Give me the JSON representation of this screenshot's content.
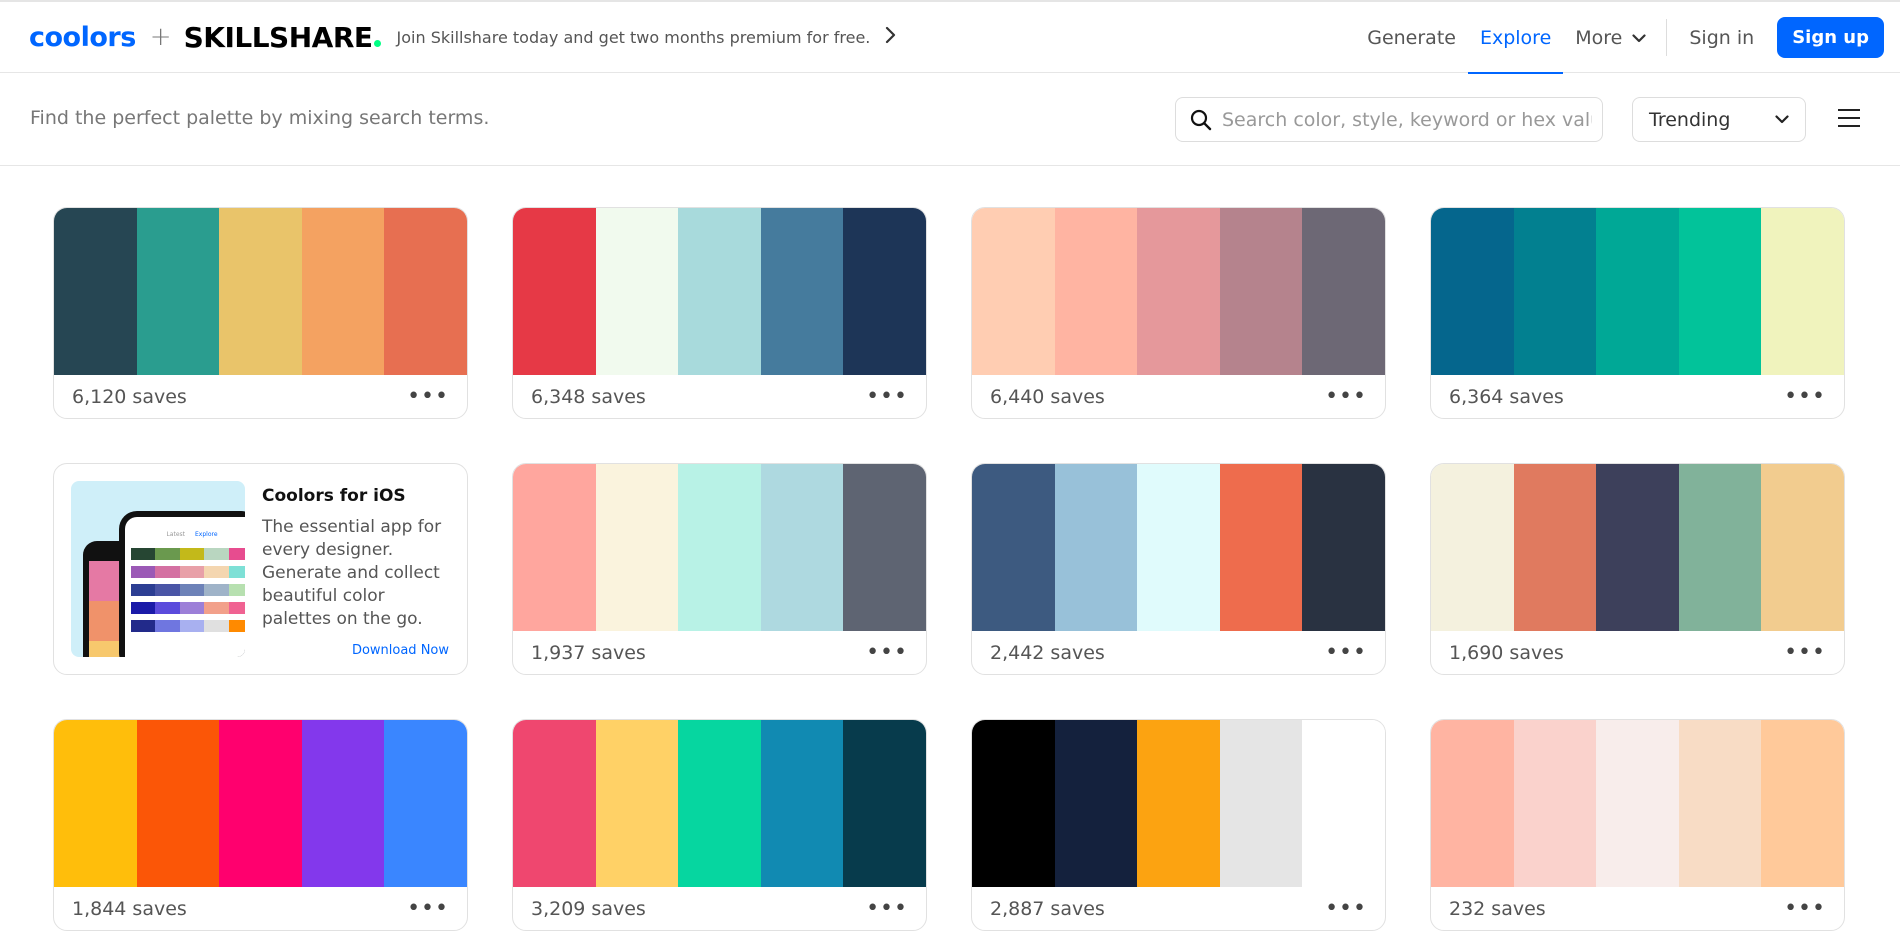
{
  "header": {
    "logo_coolors": "coolors",
    "plus": "+",
    "logo_skillshare": "SKILLSHARE",
    "promo_text": "Join Skillshare today and get two months premium for free.",
    "nav": {
      "generate": "Generate",
      "explore": "Explore",
      "more": "More",
      "sign_in": "Sign in",
      "sign_up": "Sign up"
    }
  },
  "subbar": {
    "tagline": "Find the perfect palette by mixing search terms.",
    "search_placeholder": "Search color, style, keyword or hex value",
    "sort_value": "Trending"
  },
  "promo_card": {
    "title": "Coolors for iOS",
    "description": "The essential app for every designer. Generate and collect beautiful color palettes on the go.",
    "link": "Download Now",
    "phone_tabs": [
      "Latest",
      "Explore"
    ]
  },
  "palettes": [
    {
      "saves": "6,120 saves",
      "colors": [
        "#264653",
        "#2A9D8F",
        "#E9C46A",
        "#F4A261",
        "#E76F51"
      ]
    },
    {
      "saves": "6,348 saves",
      "colors": [
        "#E63946",
        "#F1FAEE",
        "#A8DADC",
        "#457B9D",
        "#1D3557"
      ]
    },
    {
      "saves": "6,440 saves",
      "colors": [
        "#FFCDB2",
        "#FFB4A2",
        "#E5989B",
        "#B5838D",
        "#6D6875"
      ]
    },
    {
      "saves": "6,364 saves",
      "colors": [
        "#05668D",
        "#028090",
        "#00A896",
        "#02C39A",
        "#F0F3BD"
      ]
    },
    {
      "promo": true
    },
    {
      "saves": "1,937 saves",
      "colors": [
        "#FFA69E",
        "#FAF3DD",
        "#B8F2E6",
        "#AED9E0",
        "#5E6472"
      ]
    },
    {
      "saves": "2,442 saves",
      "colors": [
        "#3D5A80",
        "#98C1D9",
        "#E0FBFC",
        "#EE6C4D",
        "#293241"
      ]
    },
    {
      "saves": "1,690 saves",
      "colors": [
        "#F4F1DE",
        "#E07A5F",
        "#3D405B",
        "#81B29A",
        "#F2CC8F"
      ]
    },
    {
      "saves": "1,844 saves",
      "colors": [
        "#FFBE0B",
        "#FB5607",
        "#FF006E",
        "#8338EC",
        "#3A86FF"
      ]
    },
    {
      "saves": "3,209 saves",
      "colors": [
        "#EF476F",
        "#FFD166",
        "#06D6A0",
        "#118AB2",
        "#073B4C"
      ]
    },
    {
      "saves": "2,887 saves",
      "colors": [
        "#000000",
        "#14213D",
        "#FCA311",
        "#E5E5E5",
        "#FFFFFF"
      ]
    },
    {
      "saves": "232 saves",
      "colors": [
        "#FFB4A2",
        "#FAD2CC",
        "#F8EDEB",
        "#F8DCC5",
        "#FFC99A"
      ]
    }
  ],
  "more_label": "•••"
}
